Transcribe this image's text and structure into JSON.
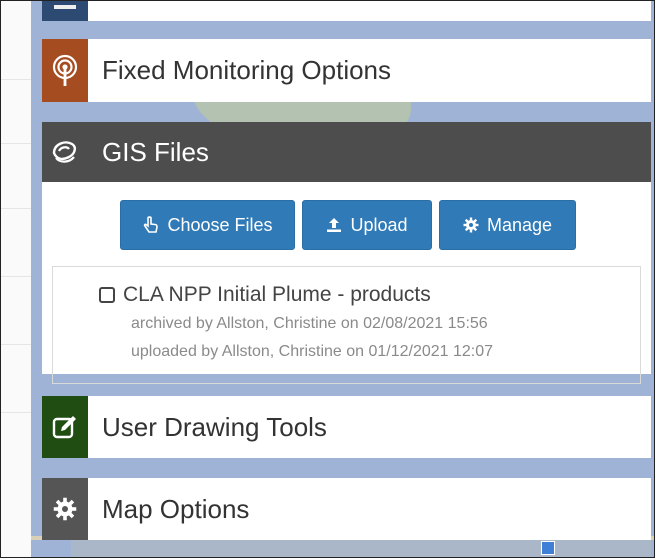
{
  "panels": {
    "fixed_monitoring": {
      "title": "Fixed Monitoring Options",
      "icon": "broadcast-icon",
      "color": "#a54c20"
    },
    "gis_files": {
      "title": "GIS Files",
      "icon": "layers-icon",
      "color": "#4d4d4d",
      "buttons": {
        "choose": {
          "label": "Choose Files",
          "icon": "hand-pointer-icon"
        },
        "upload": {
          "label": "Upload",
          "icon": "upload-icon"
        },
        "manage": {
          "label": "Manage",
          "icon": "gear-icon"
        }
      },
      "files": [
        {
          "name": "CLA NPP Initial Plume - products",
          "checked": false,
          "archived": "archived by Allston, Christine on 02/08/2021 15:56",
          "uploaded": "uploaded by Allston, Christine on 01/12/2021 12:07"
        }
      ]
    },
    "user_drawing": {
      "title": "User Drawing Tools",
      "icon": "edit-icon",
      "color": "#1f4d12"
    },
    "map_options": {
      "title": "Map Options",
      "icon": "gear-icon",
      "color": "#555555"
    }
  },
  "colors": {
    "button_blue": "#2f7ab7",
    "map_background": "#9fb3d6"
  }
}
